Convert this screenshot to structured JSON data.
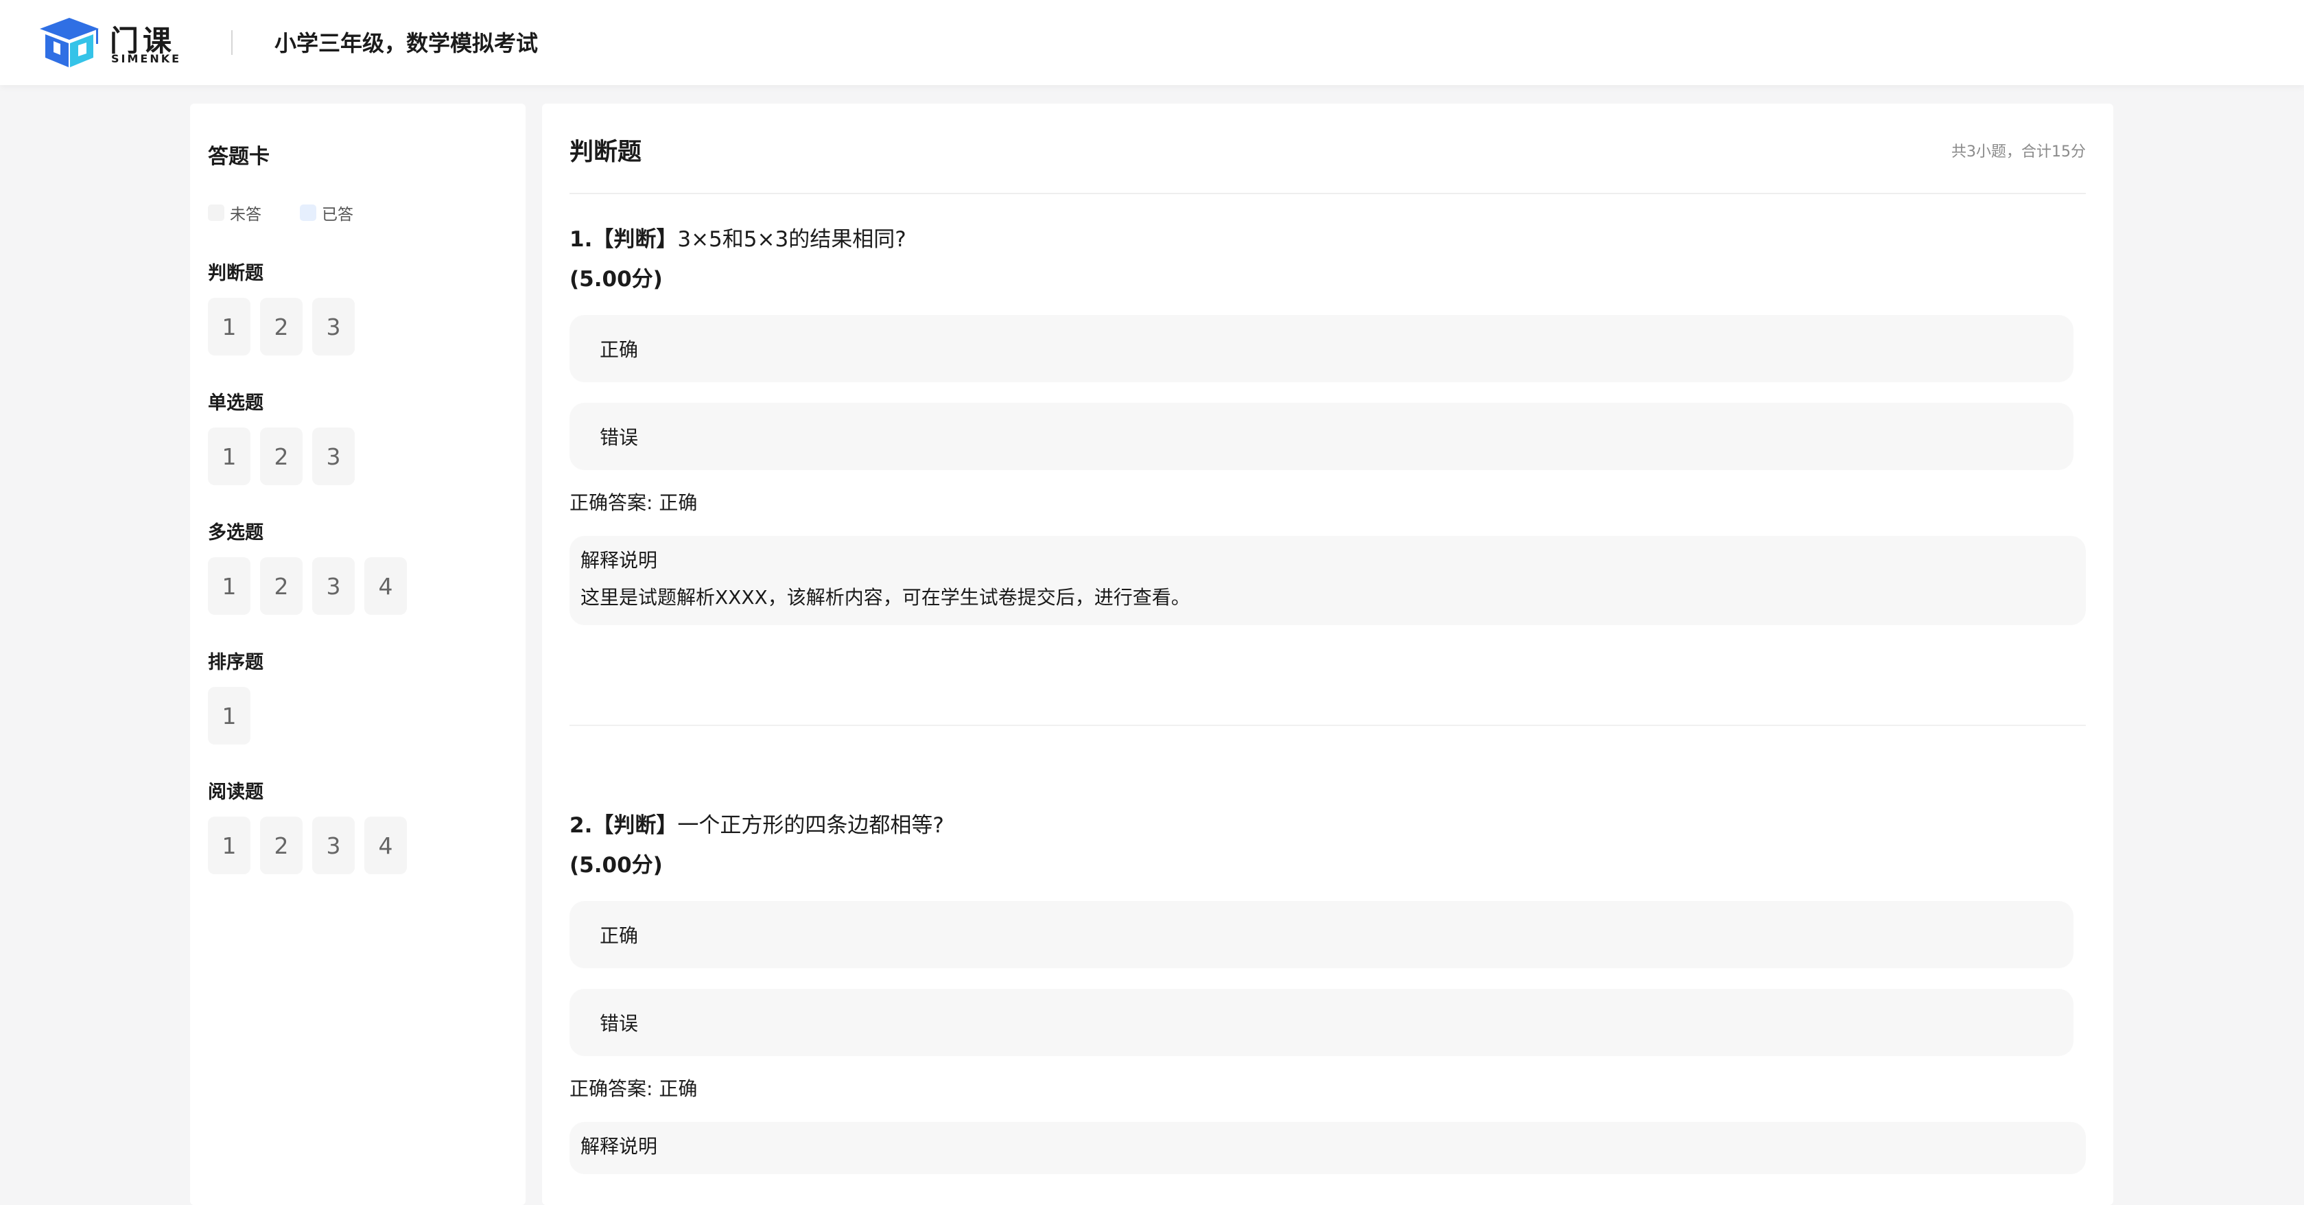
{
  "header": {
    "brand_cn": "门课",
    "brand_en": "SIMENKE",
    "exam_title": "小学三年级，数学模拟考试"
  },
  "sidebar": {
    "title": "答题卡",
    "legend": {
      "unanswered": "未答",
      "answered": "已答"
    },
    "groups": [
      {
        "title": "判断题",
        "items": [
          "1",
          "2",
          "3"
        ]
      },
      {
        "title": "单选题",
        "items": [
          "1",
          "2",
          "3"
        ]
      },
      {
        "title": "多选题",
        "items": [
          "1",
          "2",
          "3",
          "4"
        ]
      },
      {
        "title": "排序题",
        "items": [
          "1"
        ]
      },
      {
        "title": "阅读题",
        "items": [
          "1",
          "2",
          "3",
          "4"
        ]
      }
    ]
  },
  "main": {
    "section_title": "判断题",
    "summary": "共3小题，合计15分",
    "questions": [
      {
        "number": "1.",
        "tag": "【判断】",
        "text": "3×5和5×3的结果相同?",
        "score": "(5.00分)",
        "options": [
          "正确",
          "错误"
        ],
        "correct_answer": "正确答案: 正确",
        "explain_title": "解释说明",
        "explain_text": "这里是试题解析XXXX，该解析内容，可在学生试卷提交后，进行查看。"
      },
      {
        "number": "2.",
        "tag": "【判断】",
        "text": "一个正方形的四条边都相等?",
        "score": "(5.00分)",
        "options": [
          "正确",
          "错误"
        ],
        "correct_answer": "正确答案: 正确",
        "explain_title": "解释说明"
      }
    ]
  },
  "colors": {
    "logo_blue": "#2f6fe4",
    "logo_cyan": "#35c3e8",
    "answered": "#e6effd",
    "unanswered": "#f3f3f3"
  }
}
